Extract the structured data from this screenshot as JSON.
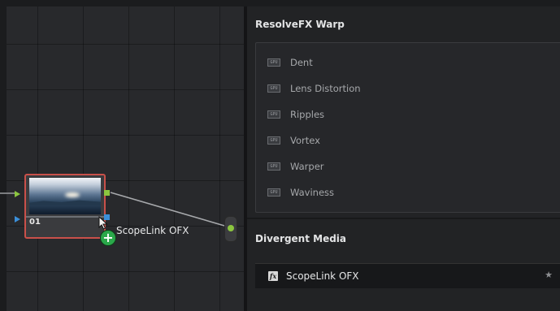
{
  "node_editor": {
    "node": {
      "label": "01"
    },
    "drag_label": "ScopeLink OFX"
  },
  "effects_panel": {
    "sections": [
      {
        "title": "ResolveFX Warp",
        "items": [
          {
            "badge": "GPU",
            "label": "Dent"
          },
          {
            "badge": "GPU",
            "label": "Lens Distortion"
          },
          {
            "badge": "GPU",
            "label": "Ripples"
          },
          {
            "badge": "GPU",
            "label": "Vortex"
          },
          {
            "badge": "GPU",
            "label": "Warper"
          },
          {
            "badge": "GPU",
            "label": "Waviness"
          }
        ]
      },
      {
        "title": "Divergent Media",
        "items": [
          {
            "badge": "fx",
            "label": "ScopeLink OFX",
            "favorite": "★"
          }
        ]
      }
    ]
  },
  "colors": {
    "node_border": "#c9504a",
    "port_green": "#8cc63f",
    "port_blue": "#3b8fd9",
    "add_badge": "#2aa84a"
  },
  "icons": {
    "add": "plus-icon",
    "cursor": "cursor-arrow-icon",
    "favorite": "star-icon",
    "badge": "gpu-badge-icon"
  }
}
